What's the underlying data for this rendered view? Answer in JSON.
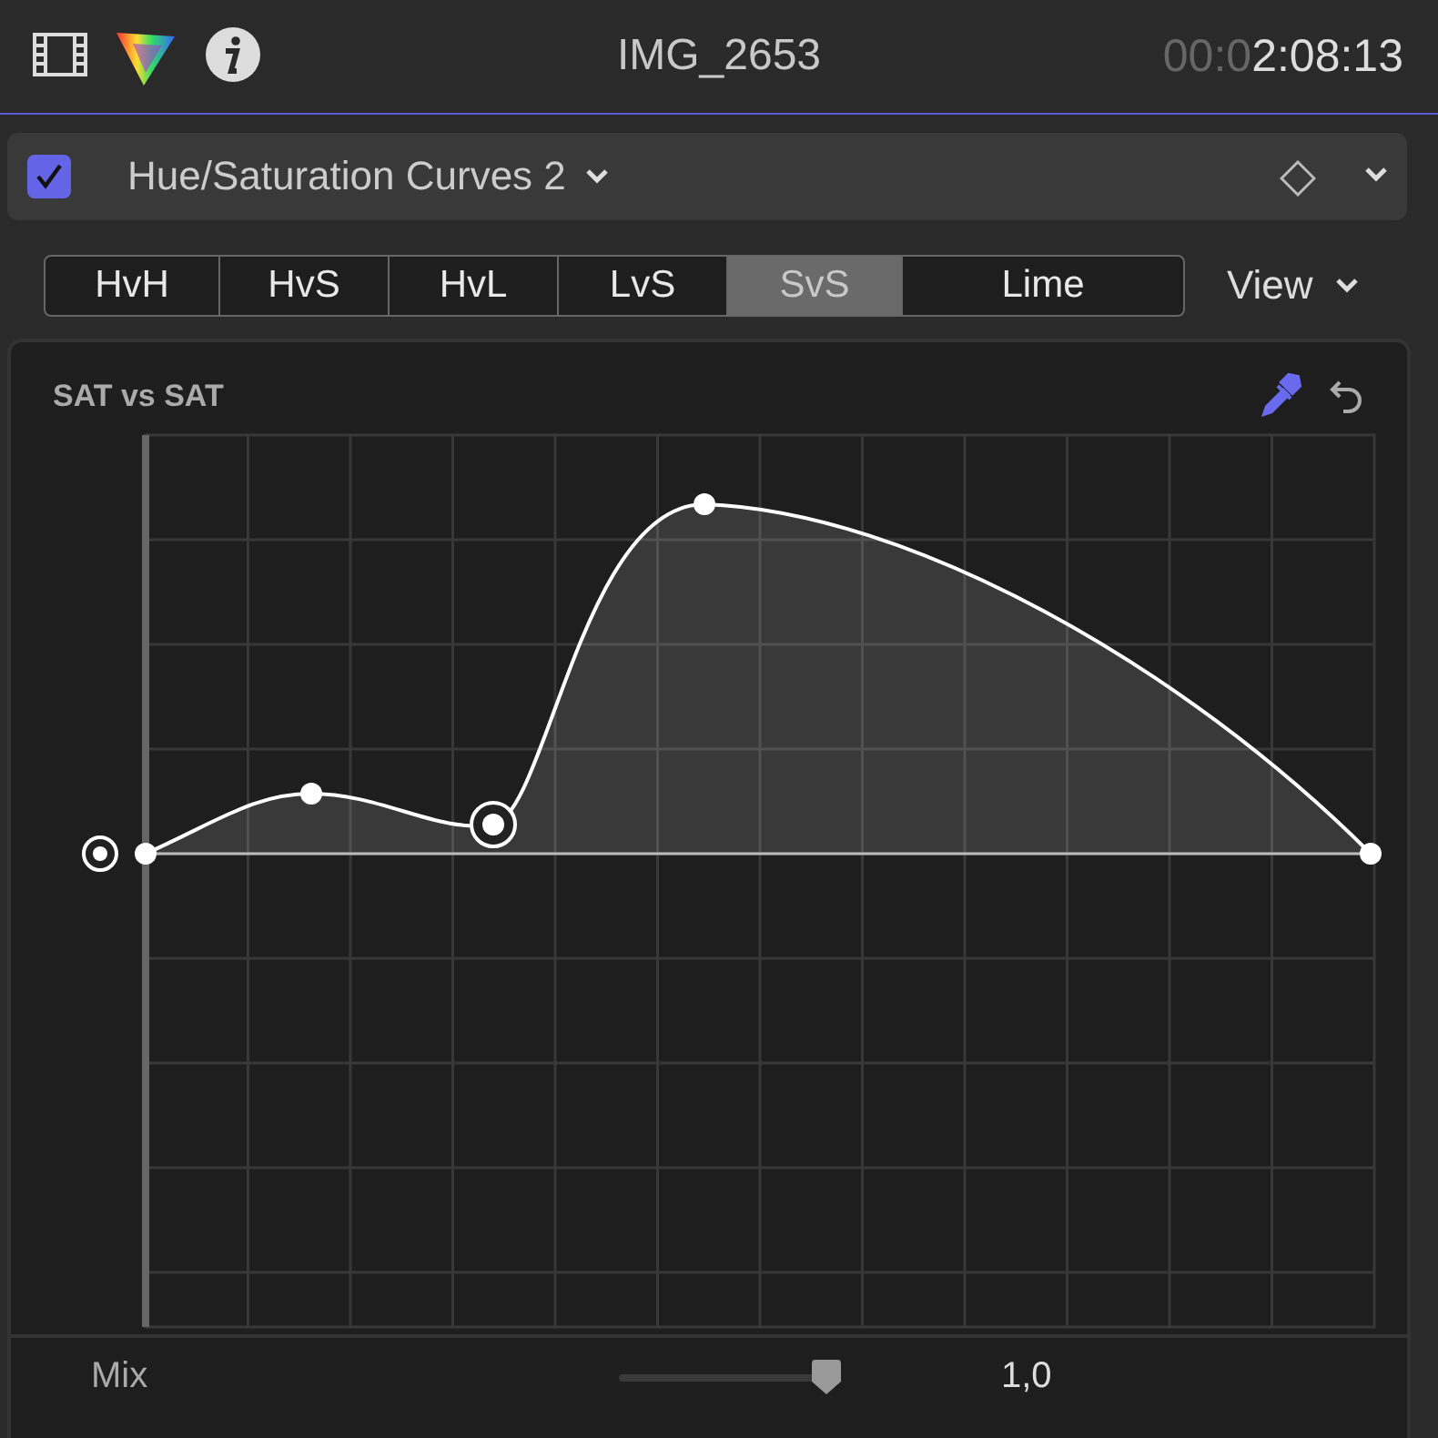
{
  "header": {
    "title": "IMG_2653",
    "timecode_dim": "00:0",
    "timecode": "2:08:13"
  },
  "effect": {
    "enabled": true,
    "name": "Hue/Saturation Curves 2"
  },
  "tabs": [
    {
      "label": "HvH",
      "selected": false
    },
    {
      "label": "HvS",
      "selected": false
    },
    {
      "label": "HvL",
      "selected": false
    },
    {
      "label": "LvS",
      "selected": false
    },
    {
      "label": "SvS",
      "selected": true
    },
    {
      "label": "Lime",
      "selected": false
    }
  ],
  "view_menu": {
    "label": "View"
  },
  "curve": {
    "title": "SAT vs SAT",
    "points": [
      {
        "selected": false
      },
      {
        "selected": false
      },
      {
        "selected": true
      },
      {
        "selected": false
      },
      {
        "selected": false
      }
    ]
  },
  "mix": {
    "label": "Mix",
    "level": 0.95,
    "value": "1,0"
  }
}
